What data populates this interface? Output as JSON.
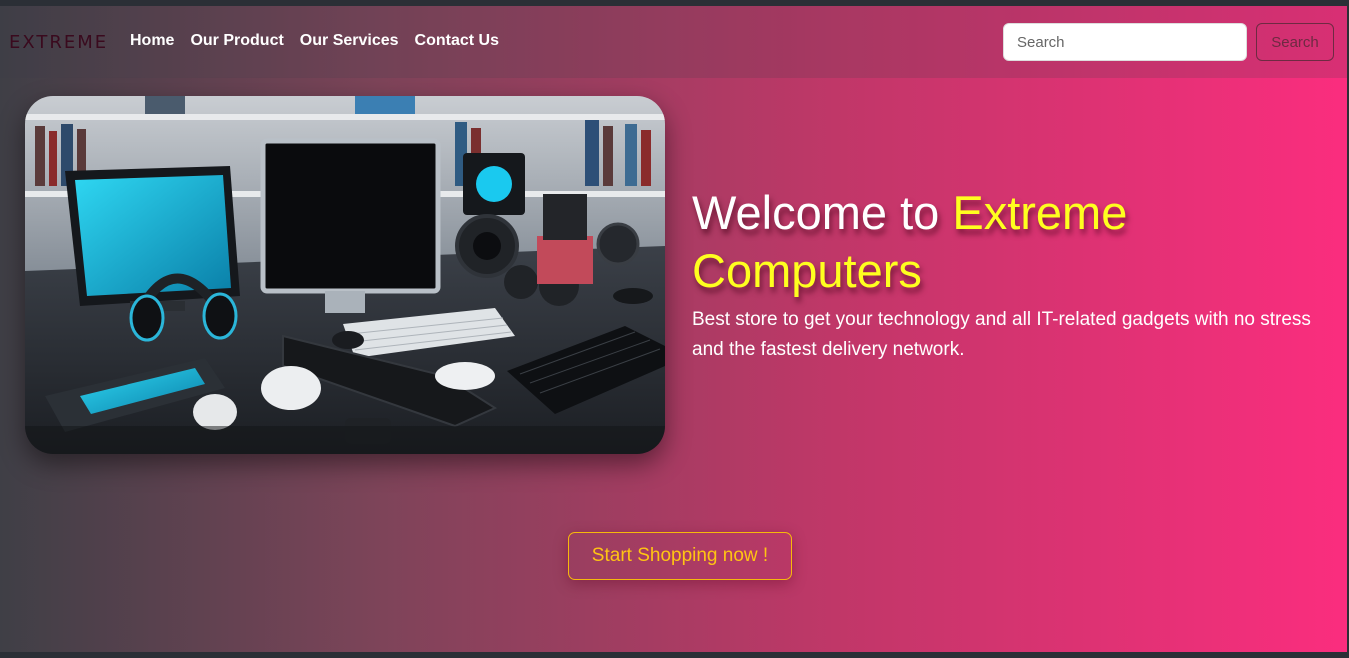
{
  "navbar": {
    "brand": "EXTREME",
    "links": [
      "Home",
      "Our Product",
      "Our Services",
      "Contact Us"
    ],
    "search": {
      "placeholder": "Search",
      "value": "",
      "button_label": "Search"
    }
  },
  "hero": {
    "title_prefix": "Welcome to ",
    "title_accent": "Extreme Computers",
    "subtitle": "Best store to get your technology and all IT-related gadgets with no stress and the fastest delivery network.",
    "cta_label": "Start Shopping now !"
  },
  "colors": {
    "accent_yellow": "#ffff1f",
    "cta_gold": "#ffc413",
    "gradient_start": "#3f3f46",
    "gradient_end": "#fb2d7e"
  }
}
